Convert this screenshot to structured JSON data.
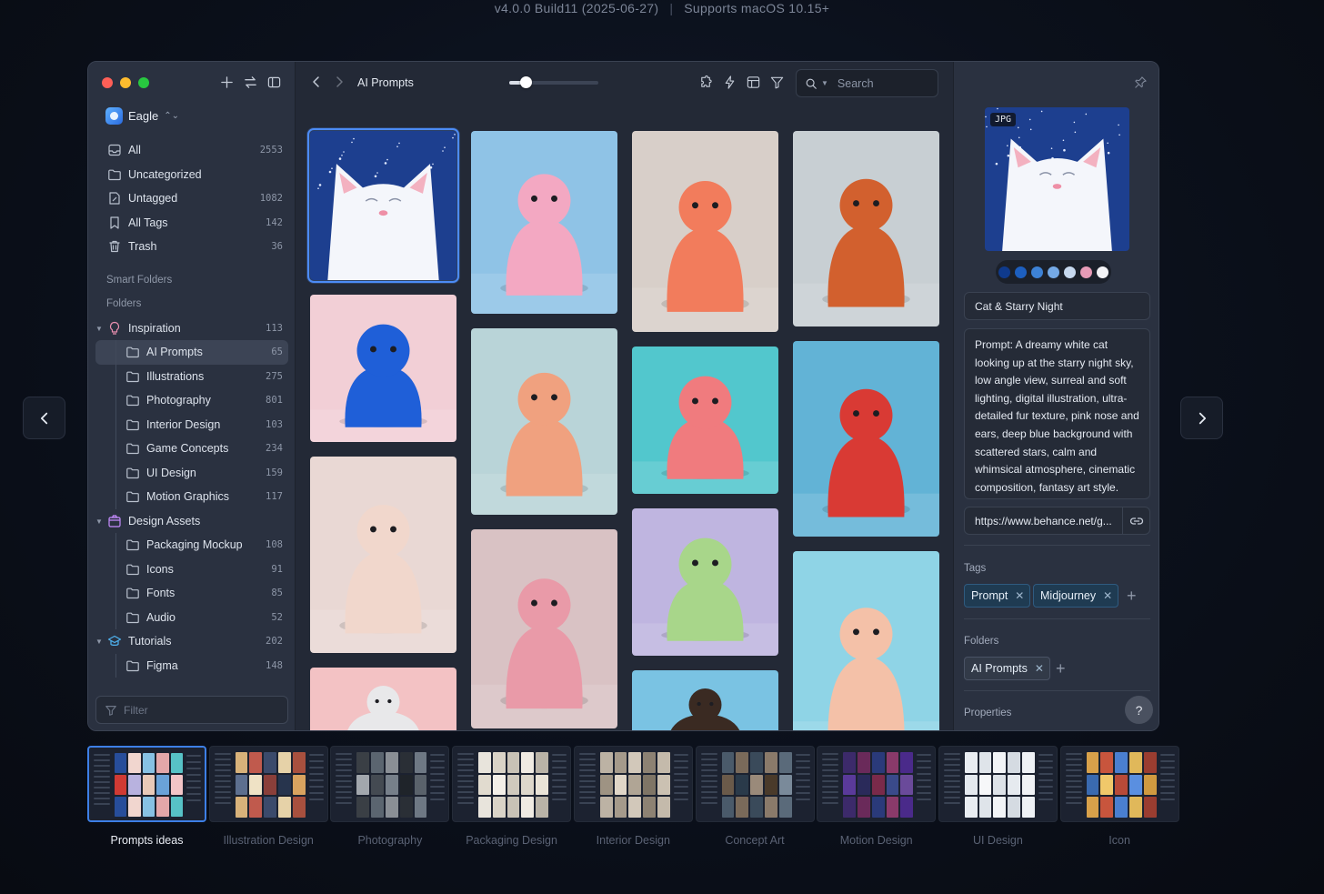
{
  "header": {
    "version": "v4.0.0 Build11  (2025-06-27)",
    "support": "Supports macOS 10.15+"
  },
  "sidebar": {
    "library_name": "Eagle",
    "items": [
      {
        "label": "All",
        "count": "2553",
        "icon": "inbox-icon"
      },
      {
        "label": "Uncategorized",
        "count": "",
        "icon": "folder-icon"
      },
      {
        "label": "Untagged",
        "count": "1082",
        "icon": "tag-outline-icon"
      },
      {
        "label": "All Tags",
        "count": "142",
        "icon": "bookmark-icon"
      },
      {
        "label": "Trash",
        "count": "36",
        "icon": "trash-icon"
      }
    ],
    "smart_folders_label": "Smart Folders",
    "folders_label": "Folders",
    "folders": [
      {
        "label": "Inspiration",
        "count": "113",
        "icon": "lightbulb-icon",
        "level": 0
      },
      {
        "label": "AI Prompts",
        "count": "65",
        "icon": "folder-icon",
        "level": 1,
        "active": true
      },
      {
        "label": "Illustrations",
        "count": "275",
        "icon": "folder-icon",
        "level": 1
      },
      {
        "label": "Photography",
        "count": "801",
        "icon": "folder-icon",
        "level": 1
      },
      {
        "label": "Interior Design",
        "count": "103",
        "icon": "folder-icon",
        "level": 1
      },
      {
        "label": "Game Concepts",
        "count": "234",
        "icon": "folder-icon",
        "level": 1
      },
      {
        "label": "UI Design",
        "count": "159",
        "icon": "folder-icon",
        "level": 1
      },
      {
        "label": "Motion Graphics",
        "count": "117",
        "icon": "folder-icon",
        "level": 1
      },
      {
        "label": "Design Assets",
        "count": "",
        "icon": "box-icon",
        "level": 0
      },
      {
        "label": "Packaging Mockup",
        "count": "108",
        "icon": "folder-icon",
        "level": 1
      },
      {
        "label": "Icons",
        "count": "91",
        "icon": "folder-icon",
        "level": 1
      },
      {
        "label": "Fonts",
        "count": "85",
        "icon": "folder-icon",
        "level": 1
      },
      {
        "label": "Audio",
        "count": "52",
        "icon": "folder-icon",
        "level": 1
      },
      {
        "label": "Tutorials",
        "count": "202",
        "icon": "cap-icon",
        "level": 0
      },
      {
        "label": "Figma",
        "count": "148",
        "icon": "folder-icon",
        "level": 1
      }
    ],
    "filter_placeholder": "Filter"
  },
  "toolbar": {
    "title": "AI Prompts",
    "thumbnail_size": 0.18,
    "search_placeholder": "Search"
  },
  "grid": {
    "items": [
      {
        "name": "white cat starry night",
        "bg": "#1d3f8f",
        "accent": "#f4f6fb",
        "selected": true
      },
      {
        "name": "blue furry monster",
        "bg": "#f2cfd6",
        "accent": "#1f5fd8"
      },
      {
        "name": "cartoon bunny",
        "bg": "#e9d8d4",
        "accent": "#f1d7cc"
      },
      {
        "name": "grey fluffy creature",
        "bg": "#f3c2c4",
        "accent": "#e8e8ea"
      },
      {
        "name": "girl with green goggles",
        "bg": "#8fc3e6",
        "accent": "#f3a8c2"
      },
      {
        "name": "girl in knit hat",
        "bg": "#b9d4d8",
        "accent": "#f0a17f"
      },
      {
        "name": "pink teddy bear",
        "bg": "#d9c2c4",
        "accent": "#e99aa8"
      },
      {
        "name": "pink tile",
        "bg": "#e7b9bc",
        "accent": "#e7b9bc"
      },
      {
        "name": "woman with snake",
        "bg": "#d8cfc9",
        "accent": "#f27c5c"
      },
      {
        "name": "pink bear on teal",
        "bg": "#52c7cd",
        "accent": "#f07b7e"
      },
      {
        "name": "cartoon frog",
        "bg": "#bfb5e0",
        "accent": "#a8d68a"
      },
      {
        "name": "bearded man and child",
        "bg": "#7ac3e3",
        "accent": "#3a2a22"
      },
      {
        "name": "girl with red hair",
        "bg": "#c8cfd3",
        "accent": "#d2602e"
      },
      {
        "name": "red furry dog",
        "bg": "#62b3d6",
        "accent": "#d93a34"
      },
      {
        "name": "astronaut in desert",
        "bg": "#8fd4e6",
        "accent": "#f4c1a8"
      }
    ]
  },
  "inspector": {
    "format": "JPG",
    "palette": [
      "#0f3a8c",
      "#1d5fbf",
      "#3d82d6",
      "#74a9e6",
      "#c7d9ef",
      "#e79bb7",
      "#f3f3f6"
    ],
    "title": "Cat & Starry Night",
    "note": "Prompt: A dreamy white cat looking up at the starry night sky, low angle view, surreal and soft lighting, digital illustration, ultra-detailed fur texture, pink nose and ears, deep blue background with scattered stars, calm and whimsical atmosphere, cinematic composition, fantasy art style.",
    "url": "https://www.behance.net/g...",
    "tags_label": "Tags",
    "tags": [
      "Prompt",
      "Midjourney"
    ],
    "folders_label": "Folders",
    "folders": [
      "AI Prompts"
    ],
    "properties_label": "Properties",
    "help": "?"
  },
  "strip": {
    "items": [
      {
        "label": "Prompts ideas",
        "active": true,
        "tones": [
          "#274d9a",
          "#f1d6cf",
          "#87c1e3",
          "#e3a7a9",
          "#57c2c6",
          "#d03a34",
          "#b8b2df",
          "#e8c9b8",
          "#6aa2d8",
          "#f2c4c6"
        ]
      },
      {
        "label": "Illustration Design",
        "tones": [
          "#d8b27a",
          "#c05a4d",
          "#3b4a6b",
          "#e6d2a8",
          "#a8503e",
          "#5d6f8f",
          "#efe2c5",
          "#8a3f3a",
          "#27344d",
          "#d9a35f"
        ]
      },
      {
        "label": "Photography",
        "tones": [
          "#3a3f45",
          "#5b6570",
          "#8a8f96",
          "#2a2f36",
          "#6e7884",
          "#a2a7ad",
          "#444a52",
          "#767f8a",
          "#1f242a",
          "#5a626b"
        ]
      },
      {
        "label": "Packaging Design",
        "tones": [
          "#e8e4dc",
          "#d9d3c7",
          "#c8c2b6",
          "#efeae2",
          "#b9b3a7",
          "#e1dbcf",
          "#f3efe8",
          "#cfc9bd",
          "#ddd7cb",
          "#e9e3d7"
        ]
      },
      {
        "label": "Interior Design",
        "tones": [
          "#bcb2a4",
          "#a59a8b",
          "#d2c8ba",
          "#8d8273",
          "#c4baab",
          "#9e9383",
          "#e0d6c8",
          "#b0a595",
          "#7f7566",
          "#cbc1b2"
        ]
      },
      {
        "label": "Concept Art",
        "tones": [
          "#4a5a6a",
          "#7a6a5a",
          "#3a4a5a",
          "#8a7a6a",
          "#5a6a7a",
          "#6a5a4a",
          "#2a3a4a",
          "#9a8a7a",
          "#4a3a2a",
          "#7a8a9a"
        ]
      },
      {
        "label": "Motion Design",
        "tones": [
          "#3c2a6a",
          "#6a2a5a",
          "#2a3a7a",
          "#8a3a6a",
          "#4a2a8a",
          "#5a3a9a",
          "#2a2a5a",
          "#7a2a4a",
          "#3a4a8a",
          "#6a4a9a"
        ]
      },
      {
        "label": "UI Design",
        "tones": [
          "#e9edf2",
          "#dfe4ea",
          "#f2f4f7",
          "#d5dbe2",
          "#eef1f5",
          "#e3e8ee",
          "#f6f7f9",
          "#dde2e8",
          "#e6eaef",
          "#f0f2f5"
        ]
      },
      {
        "label": "Icon",
        "tones": [
          "#d8a14a",
          "#c8553d",
          "#4a7fd0",
          "#e0b85a",
          "#9a3d30",
          "#3a6ab0",
          "#f0c86a",
          "#b84a38",
          "#5a8fe0",
          "#d09a40"
        ]
      }
    ]
  }
}
